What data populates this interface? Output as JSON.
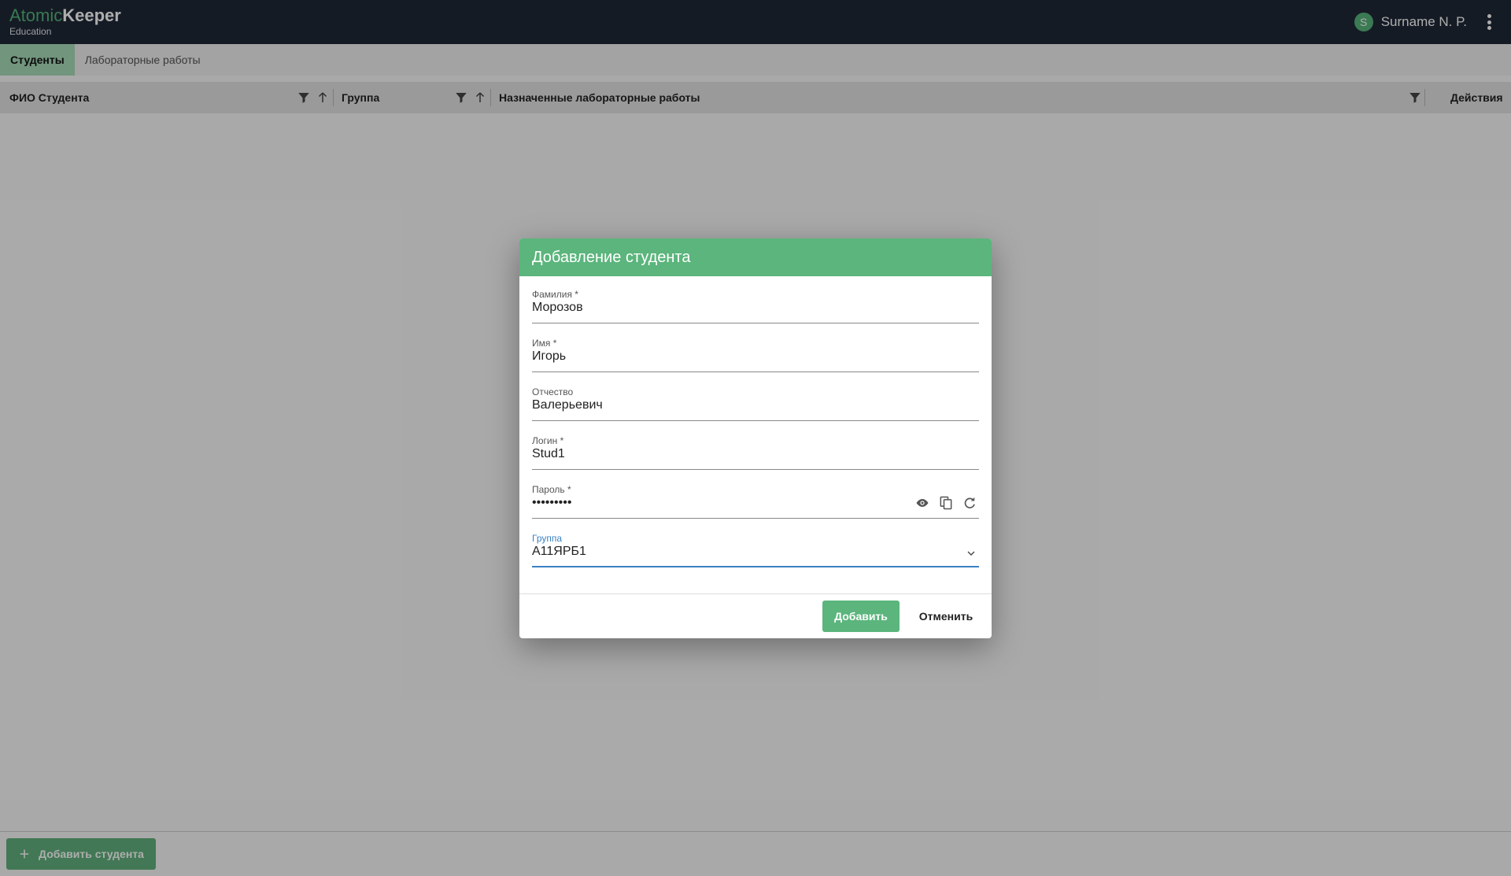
{
  "app": {
    "brand_part1": "Atomic",
    "brand_part2": "Keeper",
    "subtitle": "Education"
  },
  "user": {
    "avatar_letter": "S",
    "name": "Surname N. P."
  },
  "tabs": [
    {
      "label": "Студенты",
      "active": true
    },
    {
      "label": "Лабораторные работы",
      "active": false
    }
  ],
  "table": {
    "columns": [
      "ФИО Студента",
      "Группа",
      "Назначенные лабораторные работы",
      "Действия"
    ]
  },
  "footer": {
    "add_student_label": "Добавить студента"
  },
  "dialog": {
    "title": "Добавление студента",
    "fields": {
      "surname": {
        "label": "Фамилия *",
        "value": "Морозов"
      },
      "name": {
        "label": "Имя *",
        "value": "Игорь"
      },
      "patronymic": {
        "label": "Отчество",
        "value": "Валерьевич"
      },
      "login": {
        "label": "Логин *",
        "value": "Stud1"
      },
      "password": {
        "label": "Пароль *",
        "value": "•••••••••"
      },
      "group": {
        "label": "Группа",
        "value": "А11ЯРБ1"
      }
    },
    "add_label": "Добавить",
    "cancel_label": "Отменить"
  },
  "colors": {
    "brand_green": "#5bb57c",
    "header_bg": "#1f2937",
    "focus_blue": "#3b82c4"
  },
  "icons": [
    "avatar",
    "more-vert-icon",
    "filter-icon",
    "sort-up-icon",
    "plus-icon",
    "eye-icon",
    "copy-icon",
    "refresh-icon",
    "chevron-down-icon"
  ]
}
